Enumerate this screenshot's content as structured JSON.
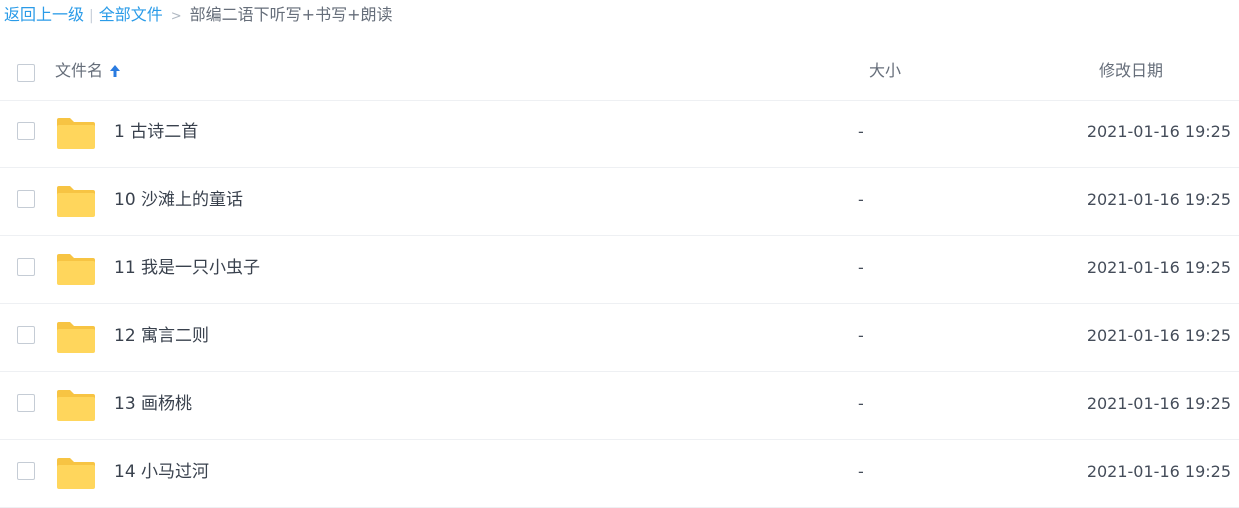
{
  "breadcrumb": {
    "back": "返回上一级",
    "separator": "|",
    "all_files": "全部文件",
    "arrow": ">",
    "current": "部编二语下听写+书写+朗读"
  },
  "table_header": {
    "name": "文件名",
    "sort_icon": "arrow-up-icon",
    "size": "大小",
    "modified": "修改日期"
  },
  "files": [
    {
      "name": "1 古诗二首",
      "size": "-",
      "modified": "2021-01-16 19:25",
      "icon": "folder-icon"
    },
    {
      "name": "10 沙滩上的童话",
      "size": "-",
      "modified": "2021-01-16 19:25",
      "icon": "folder-icon"
    },
    {
      "name": "11 我是一只小虫子",
      "size": "-",
      "modified": "2021-01-16 19:25",
      "icon": "folder-icon"
    },
    {
      "name": "12 寓言二则",
      "size": "-",
      "modified": "2021-01-16 19:25",
      "icon": "folder-icon"
    },
    {
      "name": "13 画杨桃",
      "size": "-",
      "modified": "2021-01-16 19:25",
      "icon": "folder-icon"
    },
    {
      "name": "14 小马过河",
      "size": "-",
      "modified": "2021-01-16 19:25",
      "icon": "folder-icon"
    }
  ],
  "colors": {
    "link": "#2a9be8",
    "folder": "#ffd65c",
    "folder_back": "#f7c443",
    "sort_arrow": "#2a7be0"
  }
}
